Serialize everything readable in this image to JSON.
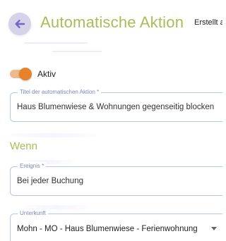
{
  "header": {
    "title": "Automatische Aktion",
    "created_info": "Erstellt a"
  },
  "toggle": {
    "label": "Aktiv",
    "state": "on",
    "color": "#e8822a"
  },
  "automation_title_field": {
    "label": "Titel der automatischen Aktion *",
    "value": "Haus Blumenwiese & Wohnungen gegenseitig blocken"
  },
  "section": {
    "heading": "Wenn"
  },
  "event_field": {
    "label": "Ereignis *",
    "value": "Bei jeder Buchung"
  },
  "unit_field": {
    "label": "Unterkunft",
    "value": "Mohn - MO - Haus Blumenwiese - Ferienwohnung"
  },
  "colors": {
    "accent_title": "#a9bc58",
    "back_button_bg": "#d6d2ea",
    "back_arrow": "#7066c8",
    "field_border": "#b9c6e6",
    "field_label": "#7d88b8"
  },
  "icons": {
    "back": "arrow-left-icon",
    "dropdown": "chevron-down-icon"
  }
}
